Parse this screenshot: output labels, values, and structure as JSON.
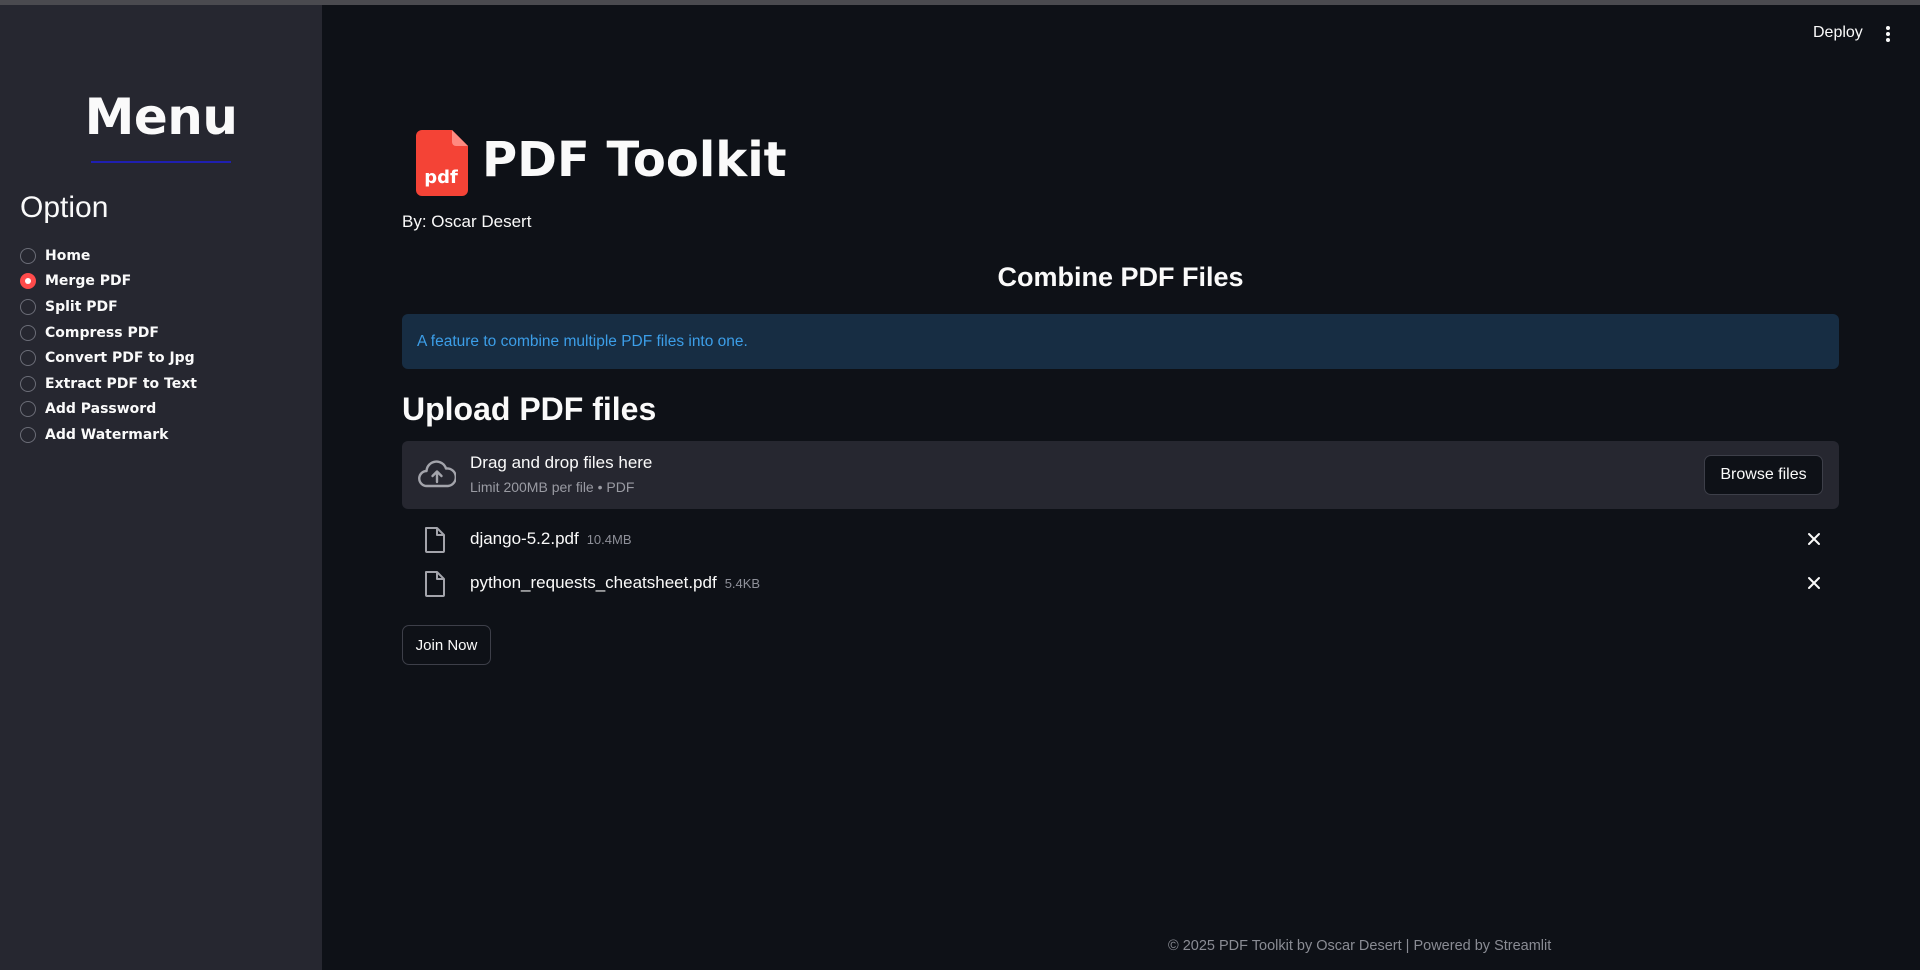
{
  "sidebar": {
    "menu_title": "Menu",
    "option_label": "Option",
    "items": [
      {
        "label": "Home",
        "checked": false
      },
      {
        "label": "Merge PDF",
        "checked": true
      },
      {
        "label": "Split PDF",
        "checked": false
      },
      {
        "label": "Compress PDF",
        "checked": false
      },
      {
        "label": "Convert PDF to Jpg",
        "checked": false
      },
      {
        "label": "Extract PDF to Text",
        "checked": false
      },
      {
        "label": "Add Password",
        "checked": false
      },
      {
        "label": "Add Watermark",
        "checked": false
      }
    ]
  },
  "header": {
    "deploy_label": "Deploy",
    "menu_icon": "kebab-menu-icon"
  },
  "main": {
    "logo_icon": "pdf-file-icon",
    "logo_text": "pdf",
    "title": "PDF Toolkit",
    "byline": "By: Oscar Desert",
    "section_title": "Combine PDF Files",
    "info": "A feature to combine multiple PDF files into one.",
    "upload_title": "Upload PDF files",
    "uploader": {
      "icon": "cloud-upload-icon",
      "main_text": "Drag and drop files here",
      "sub_text": "Limit 200MB per file • PDF",
      "browse_label": "Browse files"
    },
    "files": [
      {
        "name": "django-5.2.pdf",
        "size": "10.4MB"
      },
      {
        "name": "python_requests_cheatsheet.pdf",
        "size": "5.4KB"
      }
    ],
    "join_label": "Join Now"
  },
  "footer": "© 2025 PDF Toolkit by Oscar Desert | Powered by Streamlit",
  "colors": {
    "background": "#0e1117",
    "sidebar": "#262730",
    "accent": "#ff4b4b",
    "info_bg": "#172d43",
    "info_text": "#3c9ee8"
  }
}
